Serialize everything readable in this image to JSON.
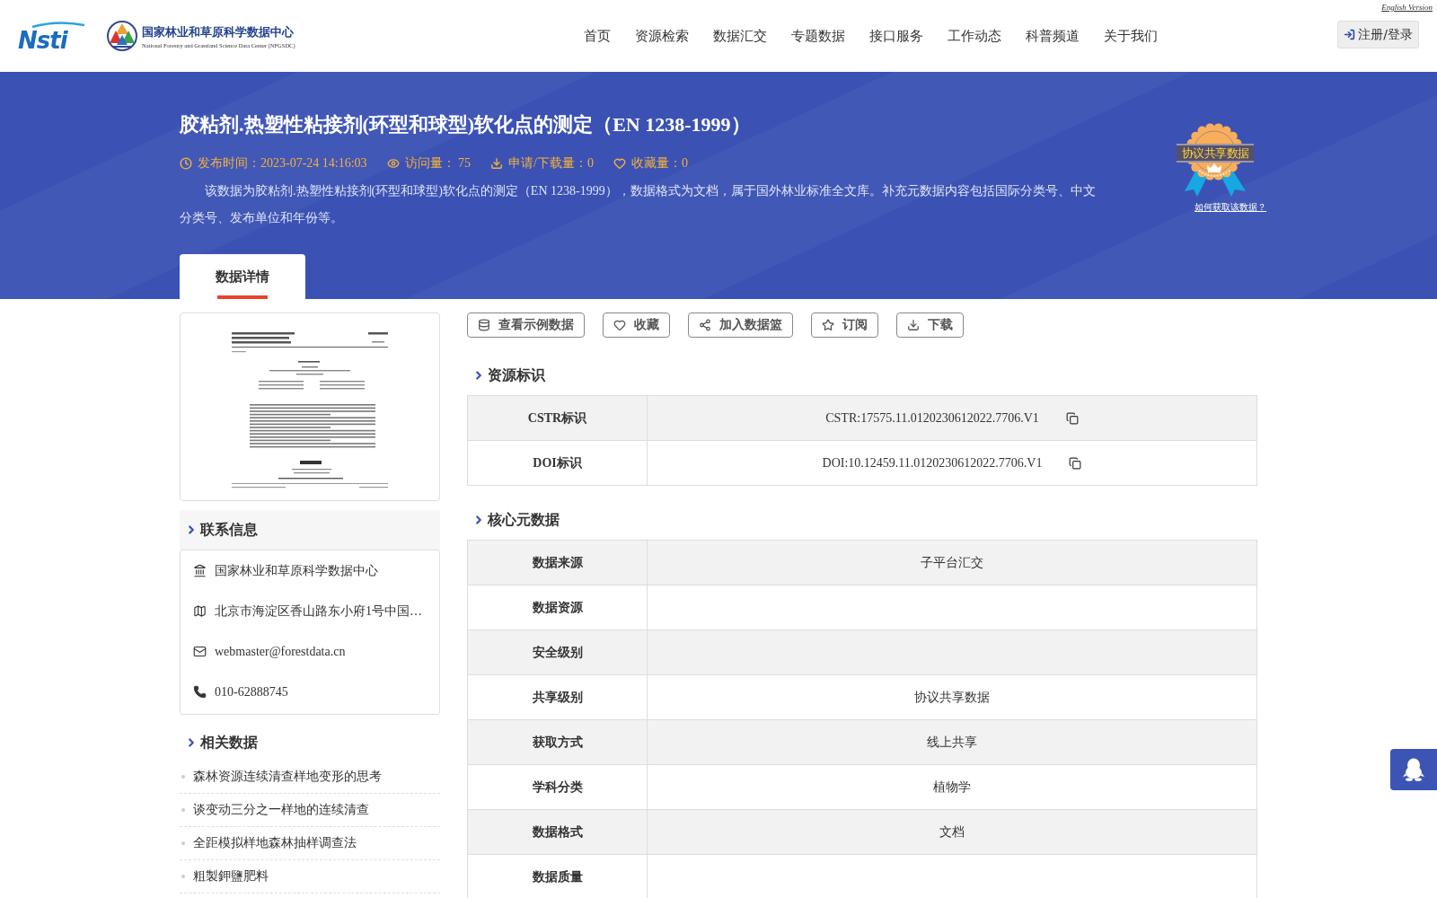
{
  "header": {
    "english_link": "English Version",
    "logo_text": "Nsti",
    "org_name": "国家林业和草原科学数据中心",
    "org_name_en": "National Forestry and Grassland Science Data Center (NFGSDC)",
    "nav": [
      "首页",
      "资源检索",
      "数据汇交",
      "专题数据",
      "接口服务",
      "工作动态",
      "科普频道",
      "关于我们"
    ],
    "login_button": "注册/登录"
  },
  "banner": {
    "title": "胶粘剂.热塑性粘接剂(环型和球型)软化点的测定（EN 1238-1999）",
    "meta": [
      {
        "kind": "published",
        "text": "发布时间：2023-07-24 14:16:03"
      },
      {
        "kind": "views",
        "text": "访问量： 75"
      },
      {
        "kind": "downloads",
        "text": "申请/下载量：0"
      },
      {
        "kind": "favorites",
        "text": "收藏量：0"
      }
    ],
    "description": "该数据为胶粘剂.热塑性粘接剂(环型和球型)软化点的测定（EN 1238-1999），数据格式为文档，属于国外林业标准全文库。补充元数据内容包括国际分类号、中文分类号、发布单位和年份等。",
    "badge": "协议共享数据",
    "help_link": "如何获取该数据？"
  },
  "tabs": [
    {
      "label": "数据详情",
      "selected": true
    }
  ],
  "sidebar": {
    "contact_title": "联系信息",
    "contact": [
      {
        "kind": "organization",
        "text": "国家林业和草原科学数据中心"
      },
      {
        "kind": "address",
        "text": "北京市海淀区香山路东小府1号中国…"
      },
      {
        "kind": "email",
        "text": "webmaster@forestdata.cn"
      },
      {
        "kind": "phone",
        "text": "010-62888745"
      }
    ],
    "related_title": "相关数据",
    "related": [
      "森林资源连续清查样地变形的思考",
      "谈变动三分之一样地的连续清查",
      "全距模拟样地森林抽样调查法",
      "粗製鉀鹽肥料"
    ]
  },
  "actions": [
    {
      "kind": "sample",
      "label": "查看示例数据"
    },
    {
      "kind": "favorite",
      "label": "收藏"
    },
    {
      "kind": "basket",
      "label": "加入数据篮"
    },
    {
      "kind": "subscribe",
      "label": "订阅"
    },
    {
      "kind": "download",
      "label": "下载"
    }
  ],
  "identifiers": {
    "title": "资源标识",
    "rows": [
      {
        "label": "CSTR标识",
        "value": "CSTR:17575.11.0120230612022.7706.V1"
      },
      {
        "label": "DOI标识",
        "value": "DOI:10.12459.11.0120230612022.7706.V1"
      }
    ]
  },
  "core_metadata": {
    "title": "核心元数据",
    "rows": [
      {
        "label": "数据来源",
        "value": "子平台汇交"
      },
      {
        "label": "数据资源"
      },
      {
        "label": "安全级别"
      },
      {
        "label": "共享级别",
        "value": "协议共享数据"
      },
      {
        "label": "获取方式",
        "value": "线上共享"
      },
      {
        "label": "学科分类",
        "value": "植物学"
      },
      {
        "label": "数据格式",
        "value": "文档"
      },
      {
        "label": "数据质量"
      }
    ]
  }
}
